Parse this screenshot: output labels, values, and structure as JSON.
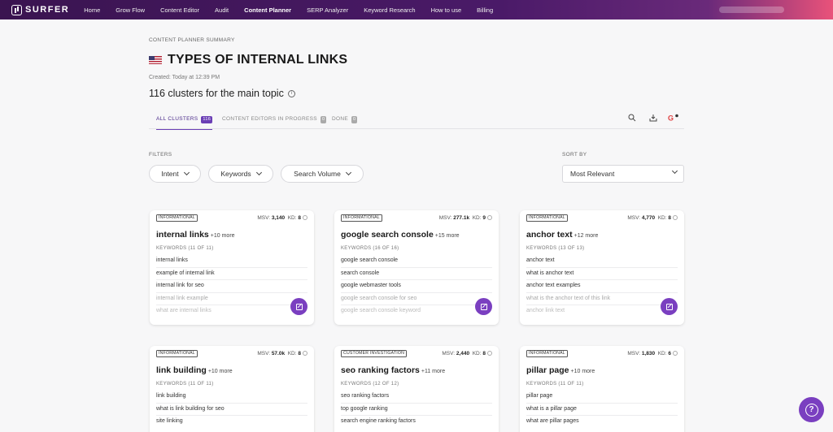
{
  "nav": {
    "logo": "SURFER",
    "items": [
      "Home",
      "Grow Flow",
      "Content Editor",
      "Audit",
      "Content Planner",
      "SERP Analyzer",
      "Keyword Research",
      "How to use",
      "Billing"
    ],
    "active": "Content Planner"
  },
  "header": {
    "breadcrumb": "CONTENT PLANNER SUMMARY",
    "title": "TYPES OF INTERNAL LINKS",
    "created": "Created: Today at 12:39 PM",
    "clusters": "116 clusters for the main topic"
  },
  "tabs": [
    {
      "label": "ALL CLUSTERS",
      "count": "116"
    },
    {
      "label": "CONTENT EDITORS IN PROGRESS",
      "count": "0"
    },
    {
      "label": "DONE",
      "count": "0"
    }
  ],
  "filters": {
    "label": "FILTERS",
    "intent": "Intent",
    "keywords": "Keywords",
    "search_volume": "Search Volume"
  },
  "sort": {
    "label": "SORT BY",
    "value": "Most Relevant"
  },
  "cards": [
    {
      "intent": "INFORMATIONAL",
      "msv_label": "MSV:",
      "msv": "3,140",
      "kd_label": "KD:",
      "kd": "8",
      "title": "internal links",
      "more": "+10 more",
      "kw_count": "KEYWORDS (11 OF 11)",
      "keywords": [
        "internal links",
        "example of internal link",
        "internal link for seo",
        "internal link example",
        "what are internal links"
      ]
    },
    {
      "intent": "INFORMATIONAL",
      "msv_label": "MSV:",
      "msv": "277.1k",
      "kd_label": "KD:",
      "kd": "9",
      "title": "google search console",
      "more": "+15 more",
      "kw_count": "KEYWORDS (16 OF 16)",
      "keywords": [
        "google search console",
        "search console",
        "google webmaster tools",
        "google search console for seo",
        "google search console keyword"
      ]
    },
    {
      "intent": "INFORMATIONAL",
      "msv_label": "MSV:",
      "msv": "4,770",
      "kd_label": "KD:",
      "kd": "8",
      "title": "anchor text",
      "more": "+12 more",
      "kw_count": "KEYWORDS (13 OF 13)",
      "keywords": [
        "anchor text",
        "what is anchor text",
        "anchor text examples",
        "what is the anchor text of this link",
        "anchor link text"
      ]
    },
    {
      "intent": "INFORMATIONAL",
      "msv_label": "MSV:",
      "msv": "57.0k",
      "kd_label": "KD:",
      "kd": "8",
      "title": "link building",
      "more": "+10 more",
      "kw_count": "KEYWORDS (11 OF 11)",
      "keywords": [
        "link building",
        "what is link building for seo",
        "site linking"
      ]
    },
    {
      "intent": "CUSTOMER INVESTIGATION",
      "msv_label": "MSV:",
      "msv": "2,440",
      "kd_label": "KD:",
      "kd": "8",
      "title": "seo ranking factors",
      "more": "+11 more",
      "kw_count": "KEYWORDS (12 OF 12)",
      "keywords": [
        "seo ranking factors",
        "top google ranking",
        "search engine ranking factors"
      ]
    },
    {
      "intent": "INFORMATIONAL",
      "msv_label": "MSV:",
      "msv": "1,830",
      "kd_label": "KD:",
      "kd": "6",
      "title": "pillar page",
      "more": "+10 more",
      "kw_count": "KEYWORDS (11 OF 11)",
      "keywords": [
        "pillar page",
        "what is a pillar page",
        "what are pillar pages"
      ]
    }
  ],
  "icons": {
    "search": "search-icon",
    "download": "download-icon",
    "google": "google-icon",
    "edit": "edit-icon",
    "help": "help-icon"
  },
  "colors": {
    "accent": "#7a3fc0",
    "nav_bg": "#3a1450"
  }
}
